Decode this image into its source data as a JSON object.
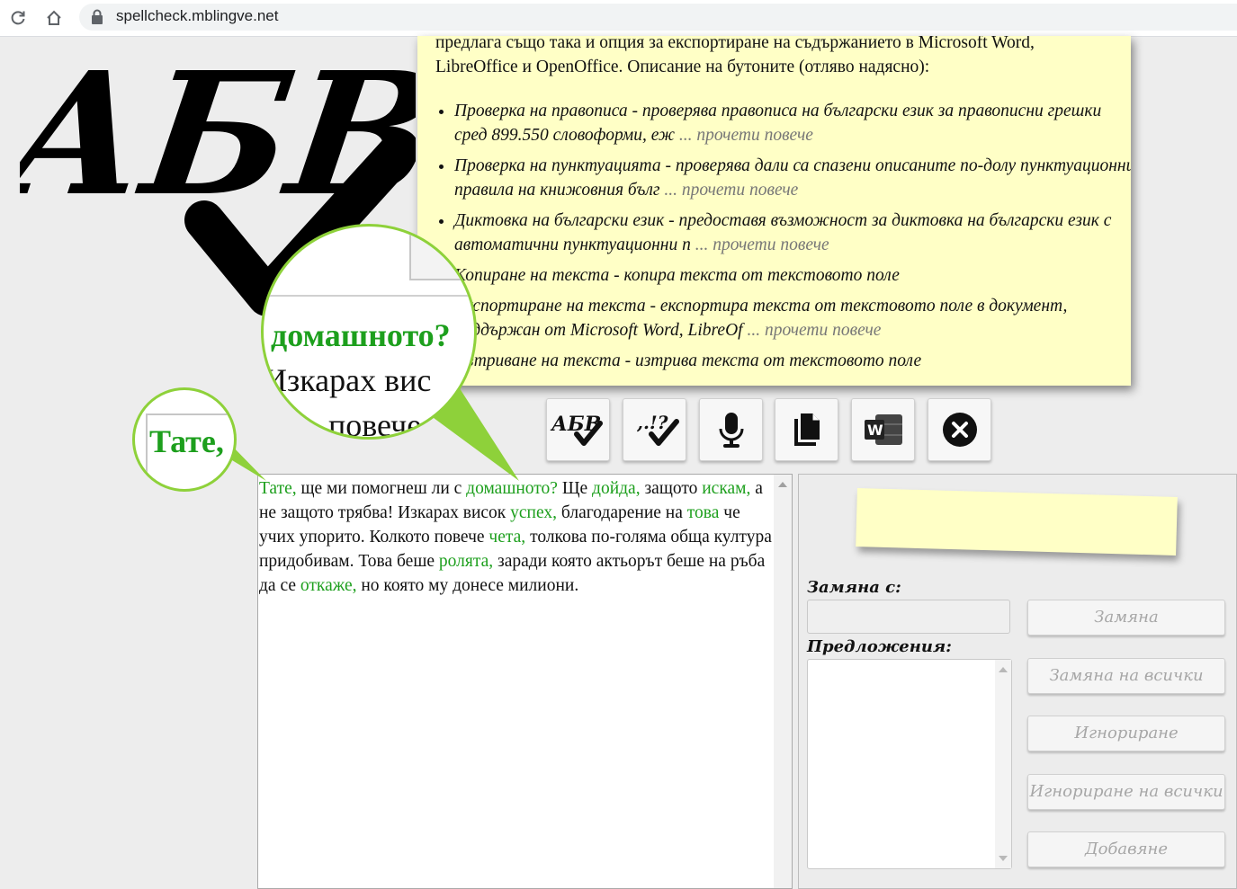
{
  "browser": {
    "url": "spellcheck.mblingve.net"
  },
  "help": {
    "intro_line1": "предлага също така и опция за експортиране на съдържанието в Microsoft Word,",
    "intro_line2": "LibreOffice и OpenOffice. Описание на бутоните (отляво надясно):",
    "items": [
      {
        "text": "Проверка на правописа - проверява правописа на български език за правописни грешки сред 899.550 словоформи, еж",
        "more": "... прочети повече"
      },
      {
        "text": "Проверка на пунктуацията - проверява дали са спазени описаните по-долу пунктуационни правила на книжовния бълг",
        "more": "... прочети повече"
      },
      {
        "text": "Диктовка на български език - предоставя възможност за диктовка на български език с автоматични пунктуационни п",
        "more": "... прочети повече"
      },
      {
        "text": "Копиране на текста - копира текста от текстовото поле",
        "more": ""
      },
      {
        "text": "Експортиране на текста - експортира текста от текстовото поле в документ, поддържан от Microsoft Word, LibreOf",
        "more": "... прочети повече"
      },
      {
        "text": "Изтриване на текста - изтрива текста от текстовото поле",
        "more": ""
      }
    ]
  },
  "toolbar": {
    "buttons": [
      {
        "icon": "spellcheck-icon",
        "label": "АБВ"
      },
      {
        "icon": "punctuation-icon",
        "label": ",.!?"
      },
      {
        "icon": "microphone-icon",
        "label": ""
      },
      {
        "icon": "copy-icon",
        "label": ""
      },
      {
        "icon": "word-export-icon",
        "label": "W"
      },
      {
        "icon": "clear-icon",
        "label": ""
      }
    ]
  },
  "editor": {
    "tokens": [
      {
        "t": "Тате,",
        "g": true
      },
      {
        "t": " ще ми помогнеш ли с ",
        "g": false
      },
      {
        "t": "домашното?",
        "g": true
      },
      {
        "t": " Ще ",
        "g": false
      },
      {
        "t": "дойда,",
        "g": true
      },
      {
        "t": " защото ",
        "g": false
      },
      {
        "t": "искам,",
        "g": true
      },
      {
        "t": " а не защото трябва! Изкарах висок ",
        "g": false
      },
      {
        "t": "успех,",
        "g": true
      },
      {
        "t": " благодарение на ",
        "g": false
      },
      {
        "t": "това",
        "g": true
      },
      {
        "t": " че учих упорито. Колкото повече ",
        "g": false
      },
      {
        "t": "чета,",
        "g": true
      },
      {
        "t": " толкова по-голяма обща култура придобивам. Това беше ",
        "g": false
      },
      {
        "t": "ролята,",
        "g": true
      },
      {
        "t": " заради която актьорът беше на ръба да се ",
        "g": false
      },
      {
        "t": "откаже,",
        "g": true
      },
      {
        "t": " но която му донесе милиони.",
        "g": false
      }
    ]
  },
  "side": {
    "replace_label": "Замяна с:",
    "suggestions_label": "Предложения:",
    "replace_value": "",
    "buttons": {
      "replace": "Замяна",
      "replace_all": "Замяна на всички",
      "ignore": "Игнориране",
      "ignore_all": "Игнориране на всички",
      "add": "Добавяне"
    }
  },
  "magnifiers": {
    "large_line1": "домашното?",
    "large_line2": "Изкарах вис",
    "large_line3": "повече",
    "small_line1": "Тате,"
  },
  "logo": {
    "text": "АБВ"
  },
  "colors": {
    "highlight": "#1d9f1d",
    "note": "#ffffc6",
    "callout": "#8ed13a"
  }
}
